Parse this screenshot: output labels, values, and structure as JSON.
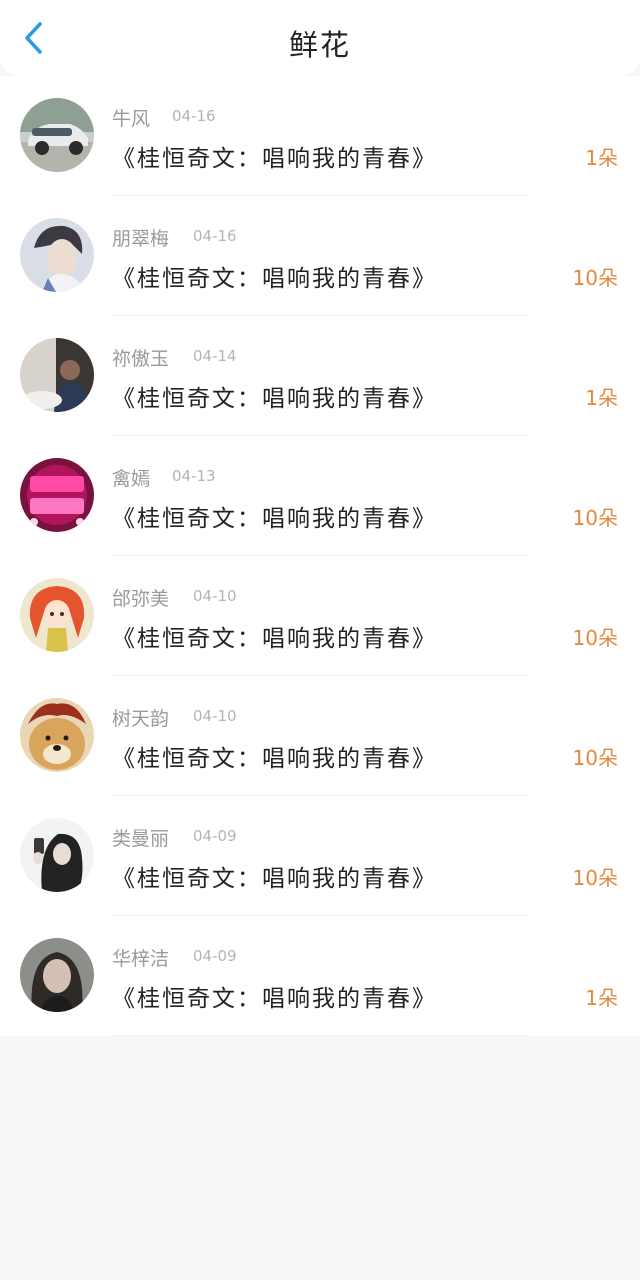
{
  "header": {
    "title": "鲜花",
    "back_icon": "chevron-left-icon",
    "accent": "#2a9be8"
  },
  "colors": {
    "count": "#e08a3c",
    "name": "#9a9a9a",
    "date": "#b5b5b5"
  },
  "records": [
    {
      "name": "牛风",
      "date": "04-16",
      "book": "《桂恒奇文：唱响我的青春》",
      "count": "1朵",
      "avatar": "car-photo-avatar"
    },
    {
      "name": "朋翠梅",
      "date": "04-16",
      "book": "《桂恒奇文：唱响我的青春》",
      "count": "10朵",
      "avatar": "young-man-portrait-avatar"
    },
    {
      "name": "祢傲玉",
      "date": "04-14",
      "book": "《桂恒奇文：唱响我的青春》",
      "count": "1朵",
      "avatar": "indoor-photo-avatar"
    },
    {
      "name": "禽嫣",
      "date": "04-13",
      "book": "《桂恒奇文：唱响我的青春》",
      "count": "10朵",
      "avatar": "valentines-day-graphic-avatar"
    },
    {
      "name": "邰弥美",
      "date": "04-10",
      "book": "《桂恒奇文：唱响我的青春》",
      "count": "10朵",
      "avatar": "anime-girl-avatar"
    },
    {
      "name": "树天韵",
      "date": "04-10",
      "book": "《桂恒奇文：唱响我的青春》",
      "count": "10朵",
      "avatar": "shiba-dog-avatar"
    },
    {
      "name": "类曼丽",
      "date": "04-09",
      "book": "《桂恒奇文：唱响我的青春》",
      "count": "10朵",
      "avatar": "phone-selfie-avatar"
    },
    {
      "name": "华梓洁",
      "date": "04-09",
      "book": "《桂恒奇文：唱响我的青春》",
      "count": "1朵",
      "avatar": "woman-portrait-avatar"
    }
  ]
}
